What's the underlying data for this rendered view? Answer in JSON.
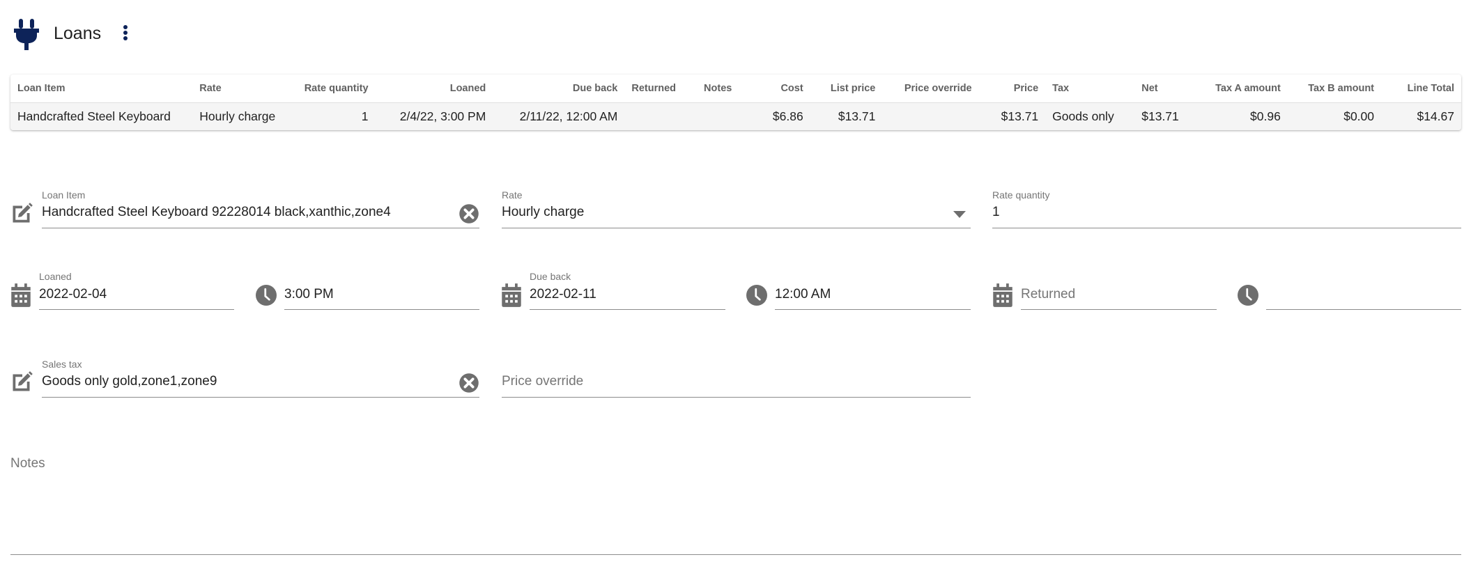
{
  "header": {
    "title": "Loans",
    "icon": "plug-icon",
    "menu_icon": "more-vert-icon",
    "accent_color": "#0d2359"
  },
  "table": {
    "columns": [
      {
        "label": "Loan Item",
        "align": "left"
      },
      {
        "label": "Rate",
        "align": "left"
      },
      {
        "label": "Rate quantity",
        "align": "right"
      },
      {
        "label": "Loaned",
        "align": "right"
      },
      {
        "label": "Due back",
        "align": "right"
      },
      {
        "label": "Returned",
        "align": "left"
      },
      {
        "label": "Notes",
        "align": "left"
      },
      {
        "label": "Cost",
        "align": "right"
      },
      {
        "label": "List price",
        "align": "right"
      },
      {
        "label": "Price override",
        "align": "right"
      },
      {
        "label": "Price",
        "align": "right"
      },
      {
        "label": "Tax",
        "align": "left"
      },
      {
        "label": "Net",
        "align": "left"
      },
      {
        "label": "Tax A amount",
        "align": "right"
      },
      {
        "label": "Tax B amount",
        "align": "right"
      },
      {
        "label": "Line Total",
        "align": "right"
      }
    ],
    "rows": [
      [
        "Handcrafted Steel Keyboard",
        "Hourly charge",
        "1",
        "2/4/22, 3:00 PM",
        "2/11/22, 12:00 AM",
        "",
        "",
        "$6.86",
        "$13.71",
        "",
        "$13.71",
        "Goods only",
        "$13.71",
        "$0.96",
        "$0.00",
        "$14.67"
      ]
    ]
  },
  "form": {
    "loan_item": {
      "label": "Loan Item",
      "value": "Handcrafted Steel Keyboard 92228014 black,xanthic,zone4",
      "icon": "edit-icon",
      "clear_icon": "clear-icon"
    },
    "rate": {
      "label": "Rate",
      "value": "Hourly charge",
      "icon": "dropdown-arrow-icon"
    },
    "rate_quantity": {
      "label": "Rate quantity",
      "value": "1"
    },
    "loaned": {
      "label": "Loaned",
      "date": "2022-02-04",
      "time": "3:00 PM"
    },
    "due_back": {
      "label": "Due back",
      "date": "2022-02-11",
      "time": "12:00 AM"
    },
    "returned": {
      "placeholder": "Returned",
      "date": "",
      "time": ""
    },
    "sales_tax": {
      "label": "Sales tax",
      "value": "Goods only gold,zone1,zone9",
      "icon": "edit-icon",
      "clear_icon": "clear-icon"
    },
    "price_override": {
      "placeholder": "Price override",
      "value": ""
    },
    "notes": {
      "placeholder": "Notes",
      "value": ""
    }
  }
}
